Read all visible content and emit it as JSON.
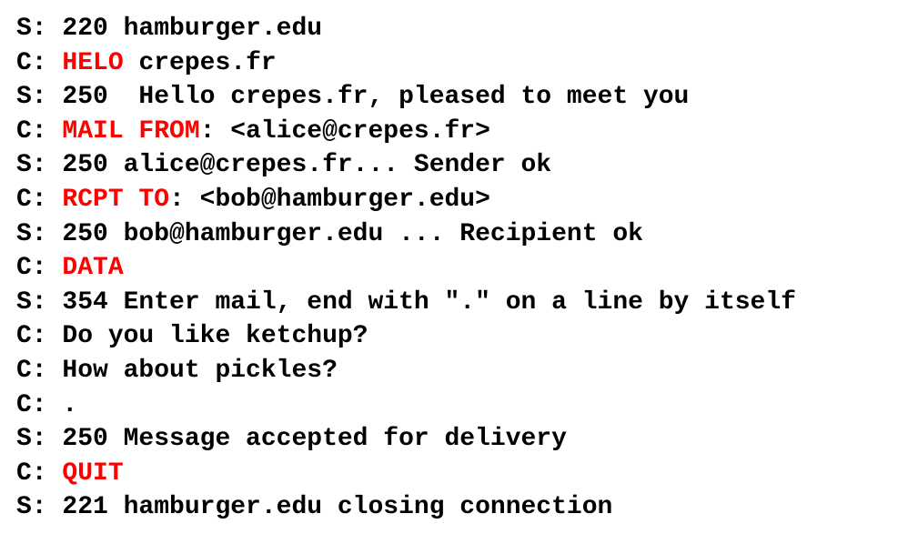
{
  "colors": {
    "text": "#000000",
    "command": "#ff0000",
    "background": "#ffffff"
  },
  "lines": [
    {
      "prefix": "S: ",
      "cmd": "",
      "rest": "220 hamburger.edu"
    },
    {
      "prefix": "C: ",
      "cmd": "HELO",
      "rest": " crepes.fr"
    },
    {
      "prefix": "S: ",
      "cmd": "",
      "rest": "250  Hello crepes.fr, pleased to meet you"
    },
    {
      "prefix": "C: ",
      "cmd": "MAIL FROM",
      "rest": ": <alice@crepes.fr>"
    },
    {
      "prefix": "S: ",
      "cmd": "",
      "rest": "250 alice@crepes.fr... Sender ok"
    },
    {
      "prefix": "C: ",
      "cmd": "RCPT TO",
      "rest": ": <bob@hamburger.edu>"
    },
    {
      "prefix": "S: ",
      "cmd": "",
      "rest": "250 bob@hamburger.edu ... Recipient ok"
    },
    {
      "prefix": "C: ",
      "cmd": "DATA",
      "rest": ""
    },
    {
      "prefix": "S: ",
      "cmd": "",
      "rest": "354 Enter mail, end with \".\" on a line by itself"
    },
    {
      "prefix": "C: ",
      "cmd": "",
      "rest": "Do you like ketchup?"
    },
    {
      "prefix": "C: ",
      "cmd": "",
      "rest": "How about pickles?"
    },
    {
      "prefix": "C: ",
      "cmd": "",
      "rest": "."
    },
    {
      "prefix": "S: ",
      "cmd": "",
      "rest": "250 Message accepted for delivery"
    },
    {
      "prefix": "C: ",
      "cmd": "QUIT",
      "rest": ""
    },
    {
      "prefix": "S: ",
      "cmd": "",
      "rest": "221 hamburger.edu closing connection"
    }
  ]
}
